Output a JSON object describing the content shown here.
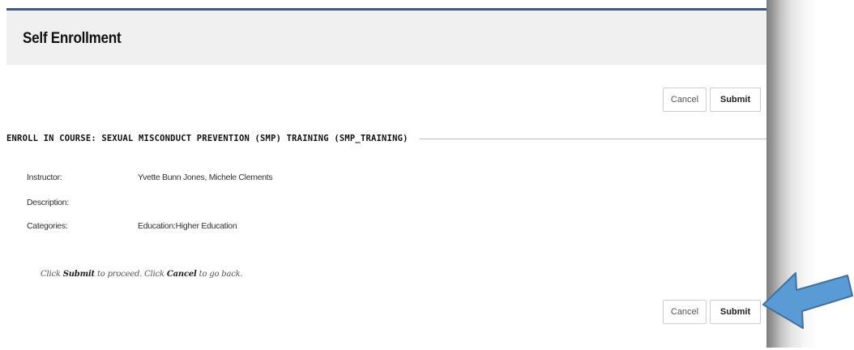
{
  "header": {
    "title": "Self Enrollment"
  },
  "actions": {
    "cancel_label": "Cancel",
    "submit_label": "Submit"
  },
  "section": {
    "heading": "ENROLL IN COURSE: SEXUAL MISCONDUCT PREVENTION (SMP) TRAINING (SMP_TRAINING)"
  },
  "fields": [
    {
      "label": "Instructor:",
      "value": "Yvette Bunn Jones, Michele Clements"
    },
    {
      "label": "Description:",
      "value": ""
    },
    {
      "label": "Categories:",
      "value": "Education:Higher Education"
    }
  ],
  "help": {
    "prefix": "Click ",
    "submit_word": "Submit",
    "middle": " to proceed. Click ",
    "cancel_word": "Cancel",
    "suffix": " to go back."
  },
  "colors": {
    "header_border": "#3e5a7d",
    "header_background": "#f0f0f0",
    "arrow_fill": "#5b9bd5",
    "arrow_stroke": "#41719c"
  },
  "annotation": {
    "icon": "arrow-pointer-icon"
  }
}
